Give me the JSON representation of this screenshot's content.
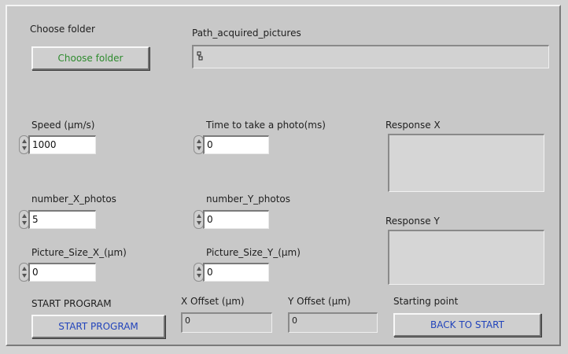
{
  "choose_folder": {
    "label": "Choose folder",
    "button_label": "Choose folder"
  },
  "path": {
    "label": "Path_acquired_pictures",
    "value": ""
  },
  "speed": {
    "label": "Speed (µm/s)",
    "value": "1000"
  },
  "time_photo": {
    "label": "Time to take a photo(ms)",
    "value": "0"
  },
  "number_x": {
    "label": "number_X_photos",
    "value": "5"
  },
  "number_y": {
    "label": "number_Y_photos",
    "value": "0"
  },
  "picture_size_x": {
    "label": "Picture_Size_X_(µm)",
    "value": "0"
  },
  "picture_size_y": {
    "label": "Picture_Size_Y_(µm)",
    "value": "0"
  },
  "response_x": {
    "label": "Response X",
    "value": ""
  },
  "response_y": {
    "label": "Response Y",
    "value": ""
  },
  "start_program": {
    "label": "START PROGRAM",
    "button_label": "START PROGRAM"
  },
  "x_offset": {
    "label": "X Offset (µm)",
    "value": "0"
  },
  "y_offset": {
    "label": "Y Offset (µm)",
    "value": "0"
  },
  "starting_point": {
    "label": "Starting point",
    "button_label": "BACK TO START"
  },
  "colors": {
    "panel_bg": "#c8c8c8",
    "choose_folder_text": "#2e8b2e",
    "action_button_text": "#2244bb"
  },
  "icons": {
    "spinner": "increment-decrement-arrows",
    "path": "path-glyph"
  }
}
